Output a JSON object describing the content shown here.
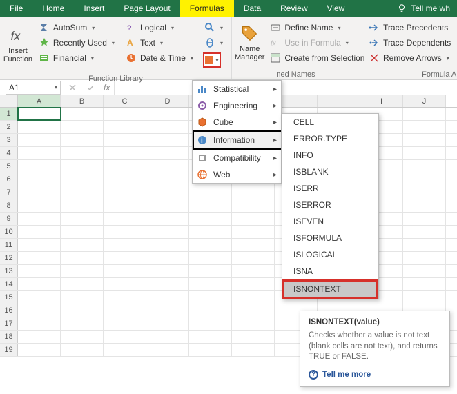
{
  "tabs": {
    "file": "File",
    "home": "Home",
    "insert": "Insert",
    "pagelayout": "Page Layout",
    "formulas": "Formulas",
    "data": "Data",
    "review": "Review",
    "view": "View",
    "tellme": "Tell me wh"
  },
  "ribbon": {
    "insert_function": "Insert Function",
    "autosum": "AutoSum",
    "recently_used": "Recently Used",
    "financial": "Financial",
    "logical": "Logical",
    "text": "Text",
    "date_time": "Date & Time",
    "function_library": "Function Library",
    "name_manager": "Name Manager",
    "define_name": "Define Name",
    "use_in_formula": "Use in Formula",
    "create_from_selection": "Create from Selection",
    "defined_names_group": "ned Names",
    "trace_precedents": "Trace Precedents",
    "trace_dependents": "Trace Dependents",
    "remove_arrows": "Remove Arrows",
    "formula_auditing": "Formula A"
  },
  "formula_bar": {
    "cell_ref": "A1"
  },
  "columns": [
    "A",
    "B",
    "C",
    "D",
    "",
    "",
    "",
    "",
    "I",
    "J"
  ],
  "rows": [
    "1",
    "2",
    "3",
    "4",
    "5",
    "6",
    "7",
    "8",
    "9",
    "10",
    "11",
    "12",
    "13",
    "14",
    "15",
    "16",
    "17",
    "18",
    "19"
  ],
  "catmenu": {
    "statistical": "Statistical",
    "engineering": "Engineering",
    "cube": "Cube",
    "information": "Information",
    "compatibility": "Compatibility",
    "web": "Web"
  },
  "functions": {
    "cell": "CELL",
    "errortype": "ERROR.TYPE",
    "info": "INFO",
    "isblank": "ISBLANK",
    "iserr": "ISERR",
    "iserror": "ISERROR",
    "iseven": "ISEVEN",
    "isformula": "ISFORMULA",
    "islogical": "ISLOGICAL",
    "isna": "ISNA",
    "isnontext": "ISNONTEXT"
  },
  "tooltip": {
    "title": "ISNONTEXT(value)",
    "desc": "Checks whether a value is not text (blank cells are not text), and returns TRUE or FALSE.",
    "more": "Tell me more"
  }
}
